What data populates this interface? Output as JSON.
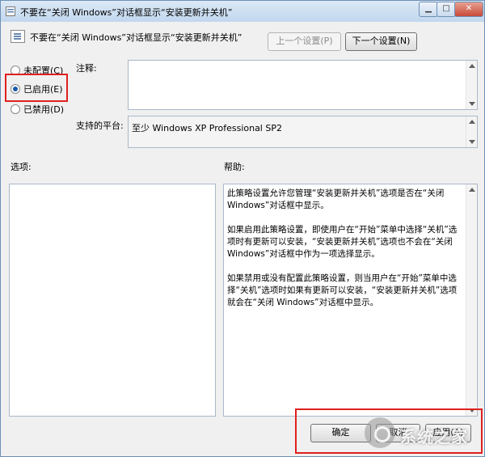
{
  "window": {
    "title": "不要在“关闭 Windows”对话框显示“安装更新并关机”",
    "controls": {
      "minimize": "▁",
      "maximize": "□",
      "close": "✕"
    }
  },
  "header": {
    "title": "不要在“关闭 Windows”对话框显示“安装更新并关机”",
    "prev_button": "上一个设置(P)",
    "next_button": "下一个设置(N)"
  },
  "state": {
    "options": [
      {
        "label": "未配置(C)",
        "checked": false
      },
      {
        "label": "已启用(E)",
        "checked": true
      },
      {
        "label": "已禁用(D)",
        "checked": false
      }
    ]
  },
  "comment": {
    "label": "注释:",
    "value": ""
  },
  "platform": {
    "label": "支持的平台:",
    "value": "至少 Windows XP Professional SP2"
  },
  "options_pane": {
    "label": "选项:"
  },
  "help_pane": {
    "label": "帮助:",
    "paragraphs": [
      "此策略设置允许您管理“安装更新并关机”选项是否在“关闭 Windows”对话框中显示。",
      "如果启用此策略设置，即使用户在“开始”菜单中选择“关机”选项时有更新可以安装，“安装更新并关机”选项也不会在“关闭 Windows”对话框中作为一项选择显示。",
      "如果禁用或没有配置此策略设置，则当用户在“开始”菜单中选择“关机”选项时如果有更新可以安装，“安装更新并关机”选项就会在“关闭 Windows”对话框中显示。"
    ]
  },
  "footer": {
    "ok": "确定",
    "cancel": "取消",
    "apply": "应用(A)"
  },
  "watermark": {
    "text": "系统之家"
  },
  "colors": {
    "highlight": "#e02020",
    "title_bar": "#c2d7ee",
    "radio_dot": "#1c5aa8"
  }
}
